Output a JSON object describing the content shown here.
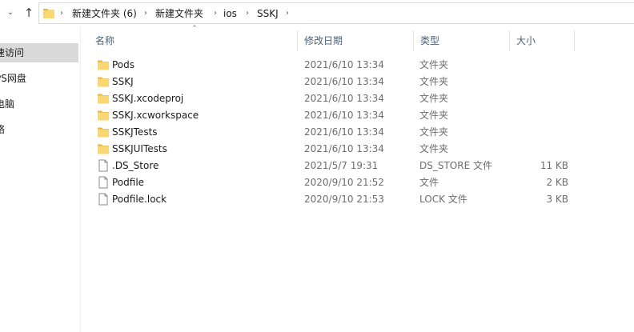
{
  "addressbar": {
    "crumbs": [
      "新建文件夹 (6)",
      "新建文件夹",
      "ios",
      "SSKJ"
    ]
  },
  "nav": {
    "items": [
      {
        "label": "速访问",
        "selected": true
      },
      {
        "label": "PS网盘",
        "selected": false
      },
      {
        "label": "电脑",
        "selected": false
      },
      {
        "label": "络",
        "selected": false
      }
    ]
  },
  "columns": {
    "name": "名称",
    "date": "修改日期",
    "type": "类型",
    "size": "大小"
  },
  "files": [
    {
      "name": "Pods",
      "date": "2021/6/10 13:34",
      "type": "文件夹",
      "size": "",
      "icon": "folder-icon"
    },
    {
      "name": "SSKJ",
      "date": "2021/6/10 13:34",
      "type": "文件夹",
      "size": "",
      "icon": "folder-icon"
    },
    {
      "name": "SSKJ.xcodeproj",
      "date": "2021/6/10 13:34",
      "type": "文件夹",
      "size": "",
      "icon": "folder-icon"
    },
    {
      "name": "SSKJ.xcworkspace",
      "date": "2021/6/10 13:34",
      "type": "文件夹",
      "size": "",
      "icon": "folder-icon"
    },
    {
      "name": "SSKJTests",
      "date": "2021/6/10 13:34",
      "type": "文件夹",
      "size": "",
      "icon": "folder-icon"
    },
    {
      "name": "SSKJUITests",
      "date": "2021/6/10 13:34",
      "type": "文件夹",
      "size": "",
      "icon": "folder-icon"
    },
    {
      "name": ".DS_Store",
      "date": "2021/5/7 19:31",
      "type": "DS_STORE 文件",
      "size": "11 KB",
      "icon": "file-icon"
    },
    {
      "name": "Podfile",
      "date": "2020/9/10 21:52",
      "type": "文件",
      "size": "2 KB",
      "icon": "file-icon"
    },
    {
      "name": "Podfile.lock",
      "date": "2020/9/10 21:53",
      "type": "LOCK 文件",
      "size": "3 KB",
      "icon": "file-icon"
    }
  ],
  "colors": {
    "folder": "#f8d775",
    "folder_dark": "#e8b53e",
    "header_text": "#4c607a",
    "selected_bg": "#d9d9d9"
  }
}
